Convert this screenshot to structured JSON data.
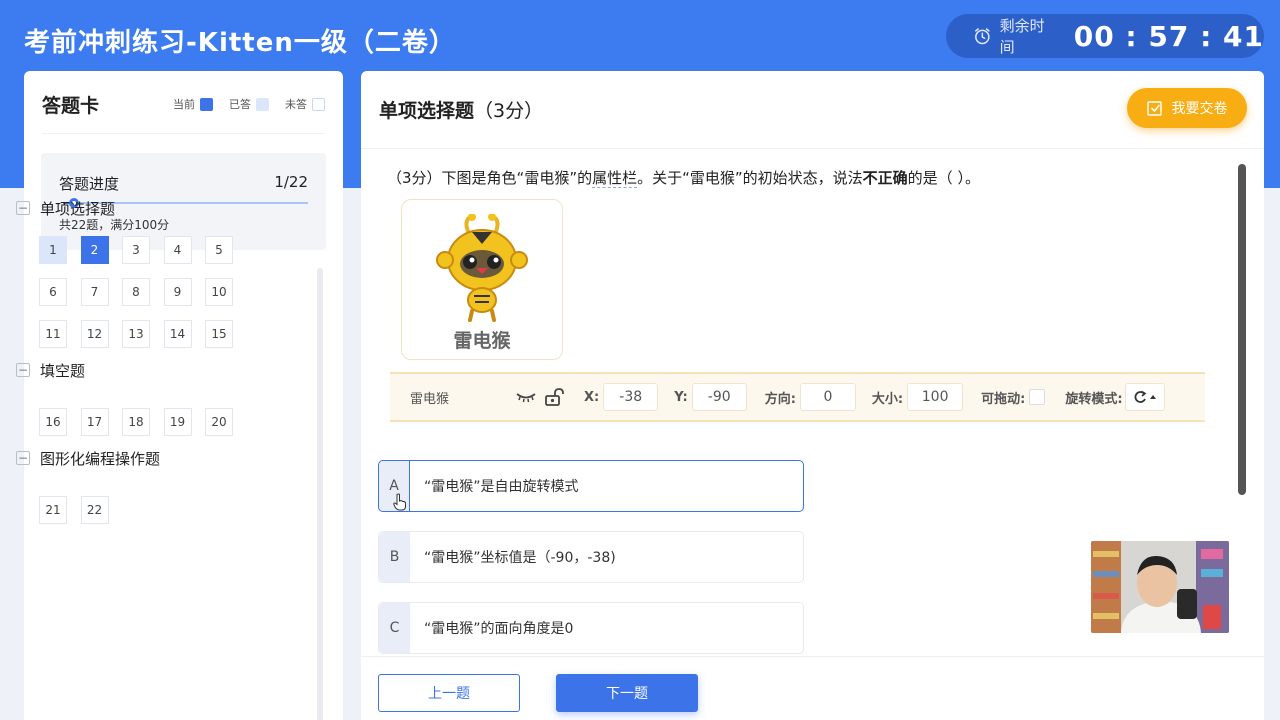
{
  "header": {
    "title": "考前冲刺练习-Kitten一级（二卷）",
    "timer_label": "剩余时间",
    "timer_value": "00 : 57 : 41"
  },
  "answer_card": {
    "title": "答题卡",
    "legend": {
      "current": "当前",
      "answered": "已答",
      "unanswered": "未答"
    },
    "progress_title": "答题进度",
    "progress_count": "1/22",
    "progress_fraction": 0.045,
    "summary": "共22题，满分100分",
    "sections": [
      {
        "name": "单项选择题",
        "toggle": "−",
        "questions": [
          "1",
          "2",
          "3",
          "4",
          "5",
          "6",
          "7",
          "8",
          "9",
          "10",
          "11",
          "12",
          "13",
          "14",
          "15"
        ]
      },
      {
        "name": "填空题",
        "toggle": "−",
        "questions": [
          "16",
          "17",
          "18",
          "19",
          "20"
        ]
      },
      {
        "name": "图形化编程操作题",
        "toggle": "−",
        "questions": [
          "21",
          "22"
        ]
      }
    ],
    "answered_question": "1",
    "current_question": "2"
  },
  "main": {
    "section_title": "单项选择题",
    "section_score": "（3分）",
    "submit_label": "我要交卷",
    "question": {
      "prefix": "（3分）下图是角色“雷电猴”的",
      "underlined": "属性栏",
      "middle": "。关于“雷电猴”的初始状态，说法",
      "bold": "不正确",
      "suffix": "的是（ ）。"
    },
    "sprite_image_label": "雷电猴",
    "property_bar": {
      "name": "雷电猴",
      "x_label": "X:",
      "x_value": "-38",
      "y_label": "Y:",
      "y_value": "-90",
      "direction_label": "方向:",
      "direction_value": "0",
      "size_label": "大小:",
      "size_value": "100",
      "draggable_label": "可拖动:",
      "rotation_label": "旋转模式:"
    },
    "options": [
      {
        "letter": "A",
        "text": "“雷电猴”是自由旋转模式"
      },
      {
        "letter": "B",
        "text": "“雷电猴”坐标值是（-90，-38)"
      },
      {
        "letter": "C",
        "text": "“雷电猴”的面向角度是0"
      }
    ],
    "prev_label": "上一题",
    "next_label": "下一题"
  },
  "colors": {
    "primary": "#3d73e8",
    "header_bg": "#3d7cf0",
    "submit": "#f8ad12"
  },
  "icons": [
    "clock-icon",
    "edit-icon",
    "eye-closed-icon",
    "unlock-icon",
    "rotate-icon",
    "collapse-icon"
  ]
}
